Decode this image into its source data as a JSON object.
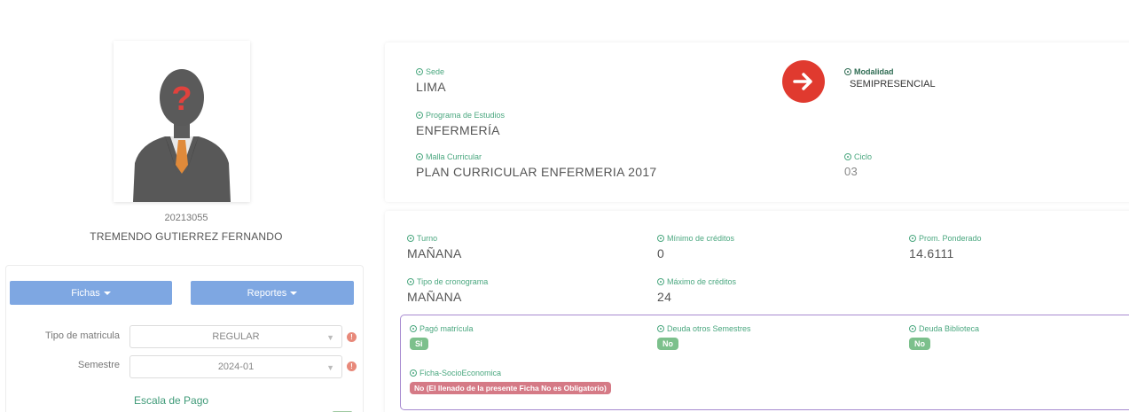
{
  "student": {
    "code": "20213055",
    "name": "TREMENDO GUTIERREZ FERNANDO"
  },
  "buttons": {
    "fichas": "Fichas",
    "reportes": "Reportes"
  },
  "form": {
    "tipo_matricula": {
      "label": "Tipo de matricula",
      "value": "REGULAR"
    },
    "semestre": {
      "label": "Semestre",
      "value": "2024-01"
    },
    "escala": "Escala de Pago"
  },
  "program": {
    "sede": {
      "label": "Sede",
      "value": "LIMA"
    },
    "modalidad": {
      "label": "Modalidad",
      "value": "SEMIPRESENCIAL"
    },
    "programa": {
      "label": "Programa de Estudios",
      "value": "ENFERMERÍA"
    },
    "malla": {
      "label": "Malla Curricular",
      "value": "PLAN CURRICULAR ENFERMERIA 2017"
    },
    "ciclo": {
      "label": "Ciclo",
      "value": "03"
    }
  },
  "enrollment": {
    "turno": {
      "label": "Turno",
      "value": "MAÑANA"
    },
    "minimo": {
      "label": "Mínimo de créditos",
      "value": "0"
    },
    "promedio": {
      "label": "Prom. Ponderado",
      "value": "14.6111"
    },
    "cronograma": {
      "label": "Tipo de cronograma",
      "value": "MAÑANA"
    },
    "maximo": {
      "label": "Máximo de créditos",
      "value": "24"
    }
  },
  "status": {
    "pago": {
      "label": "Pagó matrícula",
      "value": "Si"
    },
    "deuda_sem": {
      "label": "Deuda otros Semestres",
      "value": "No"
    },
    "deuda_bib": {
      "label": "Deuda Biblioteca",
      "value": "No"
    },
    "ficha": {
      "label": "Ficha-SocioEconomica",
      "value": "No (El llenado de la presente Ficha No es Obligatorio)"
    }
  },
  "colors": {
    "accent_green": "#4aa77f",
    "button_blue": "#7ea7e2",
    "arrow_red": "#e03a2f",
    "status_border": "#a78ad0"
  }
}
